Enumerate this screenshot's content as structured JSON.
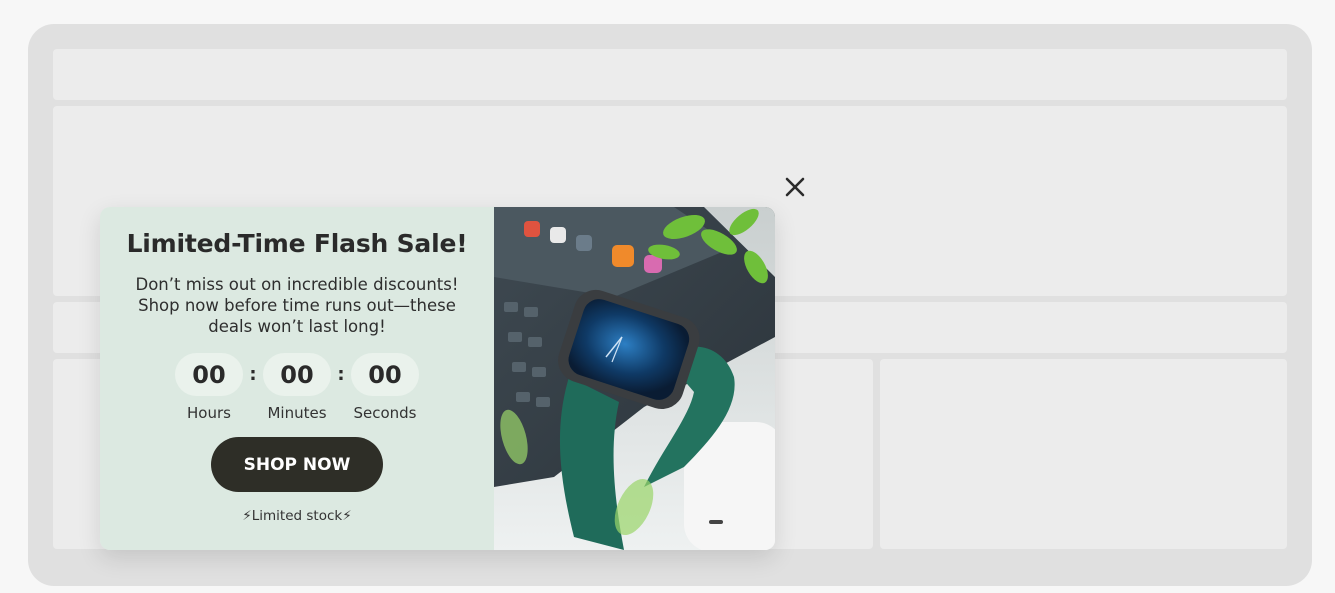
{
  "popup": {
    "title": "Limited-Time Flash Sale!",
    "description": "Don’t miss out on incredible discounts! Shop now before time runs out—these deals won’t last long!",
    "countdown": {
      "hours": "00",
      "minutes": "00",
      "seconds": "00",
      "hours_label": "Hours",
      "minutes_label": "Minutes",
      "seconds_label": "Seconds",
      "separator": ":"
    },
    "cta_label": "SHOP NOW",
    "stock_note": "⚡Limited stock⚡",
    "image_icon": "smartwatch-product-photo",
    "close_icon": "close-icon"
  },
  "colors": {
    "popup_left_bg": "#dce9e1",
    "cta_bg": "#2e2e27",
    "cta_text": "#ffffff",
    "countdown_box_bg": "#eaf2ec",
    "watch_band": "#1f6b5a"
  }
}
